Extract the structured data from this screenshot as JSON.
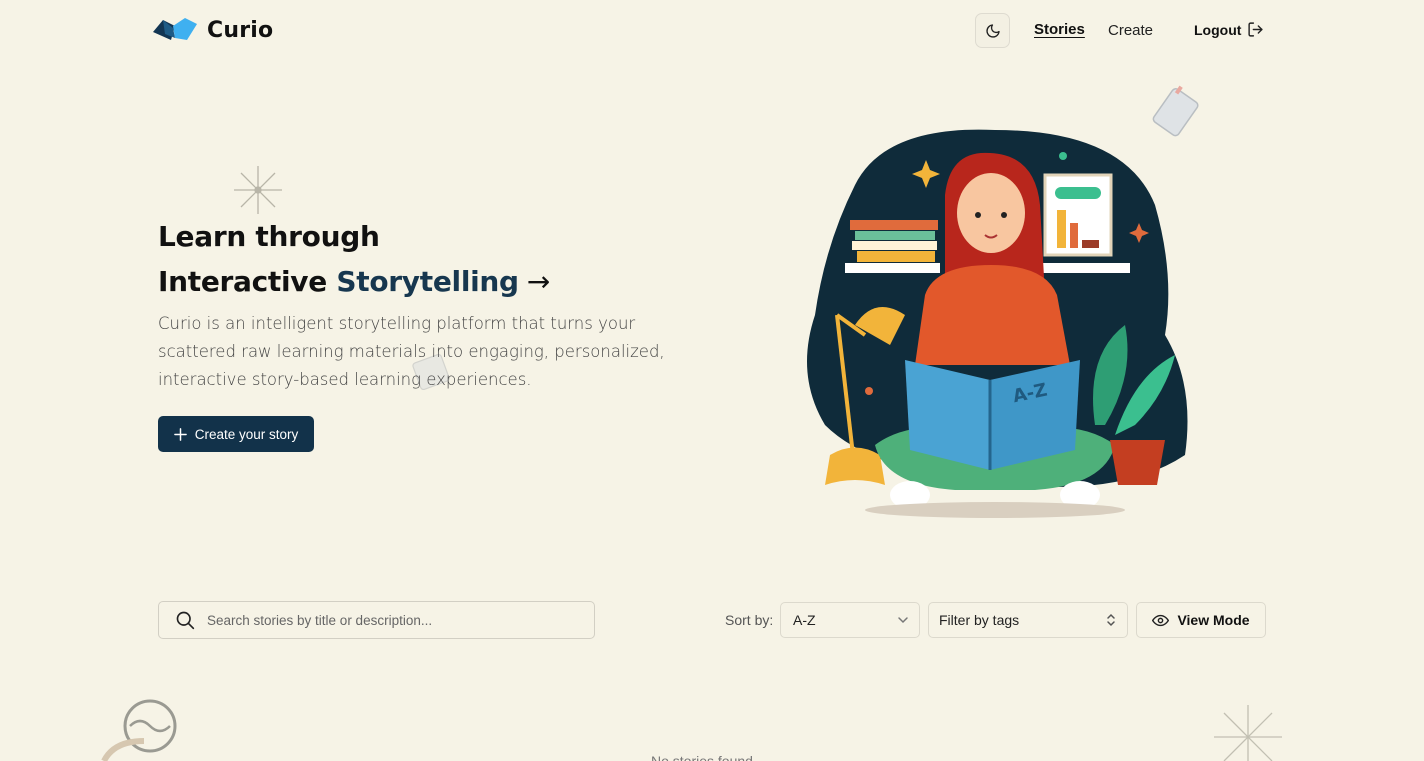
{
  "header": {
    "brand": "Curio",
    "nav_stories": "Stories",
    "nav_create": "Create",
    "logout": "Logout"
  },
  "hero": {
    "title_line1": "Learn through",
    "title_line2_plain": "Interactive",
    "title_line2_accent": "Storytelling",
    "arrow": "→",
    "description": "Curio is an intelligent storytelling platform that turns your scattered raw learning materials into engaging, personalized, interactive story-based learning experiences.",
    "cta_label": "Create your story"
  },
  "controls": {
    "search_placeholder": "Search stories by title or description...",
    "sort_label": "Sort by:",
    "sort_value": "A-Z",
    "tag_filter": "Filter by tags",
    "view_mode": "View Mode"
  },
  "content": {
    "empty_message": "No stories found"
  },
  "colors": {
    "background": "#f6f3e6",
    "primary": "#12324a",
    "accent_text": "#17374f"
  }
}
